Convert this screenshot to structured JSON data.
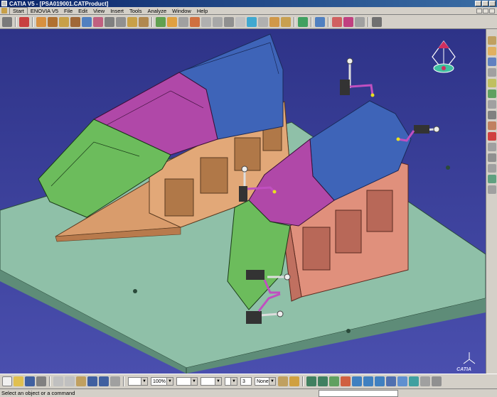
{
  "window": {
    "title": "CATIA V5 - [PSA019001.CATProduct]"
  },
  "menu": {
    "items": [
      "Start",
      "ENOVIA V5",
      "File",
      "Edit",
      "View",
      "Insert",
      "Tools",
      "Analyze",
      "Window",
      "Help"
    ]
  },
  "toolbar_bottom": {
    "zoom_value": "100%",
    "count_value": "3",
    "material_value": "None"
  },
  "status": {
    "message": "Select an object or a command"
  },
  "logo": {
    "text": "CATIA"
  },
  "colors": {
    "viewport_bg": "#353a9a",
    "base_plate": "#8fc0a8",
    "blue_part": "#3e64b8",
    "magenta_part": "#b048a8",
    "green_part": "#6cbc5c",
    "orange_support": "#d99c6c",
    "salmon_support": "#e0907c"
  }
}
